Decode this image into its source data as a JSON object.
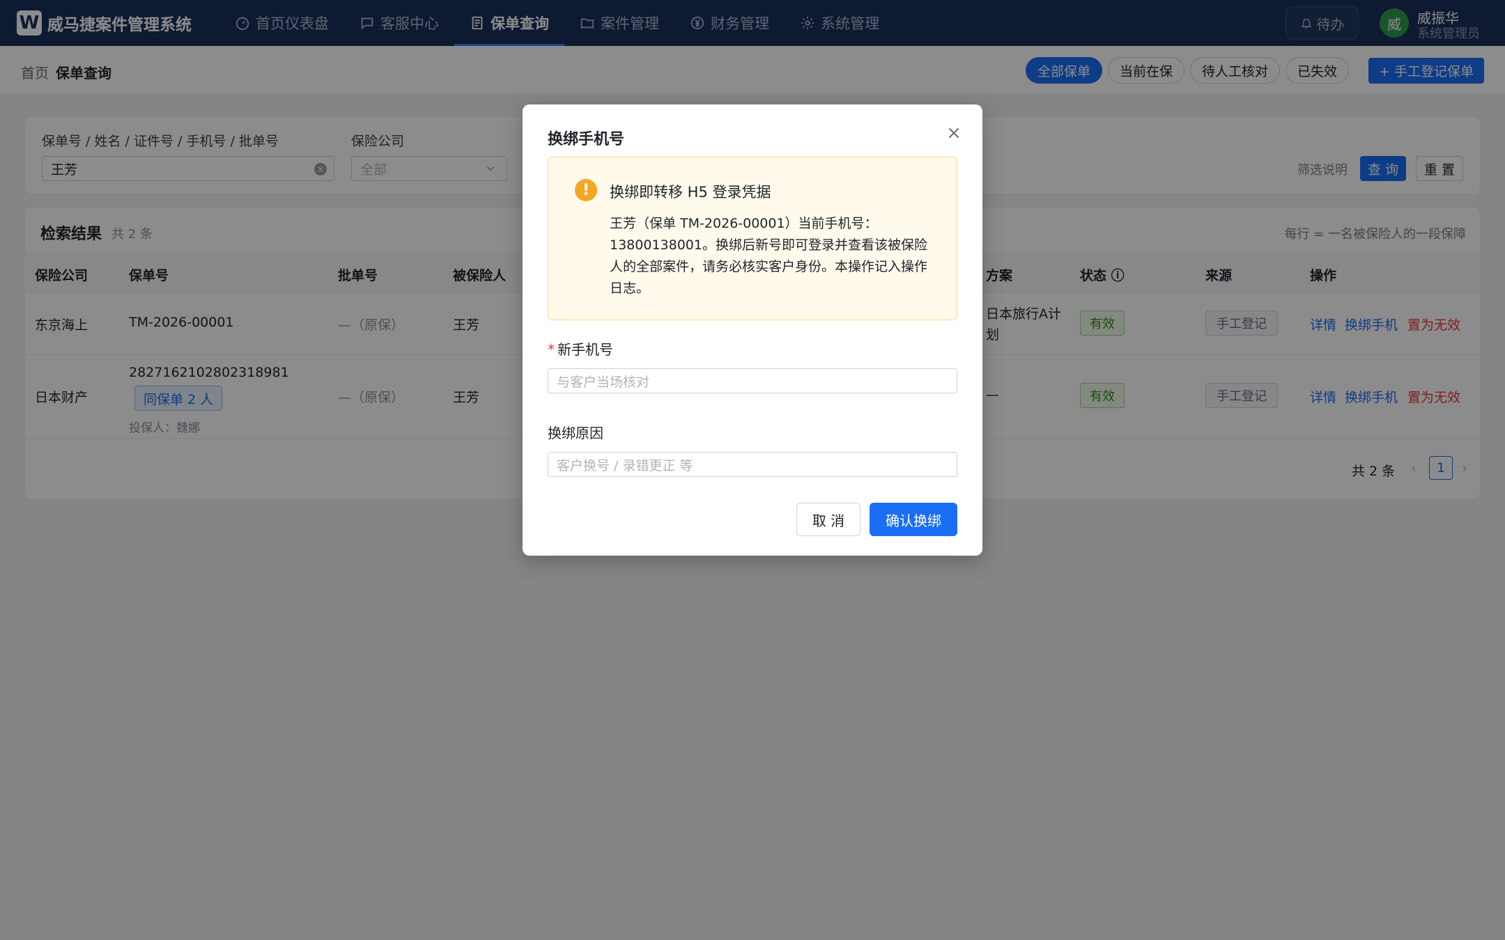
{
  "app": {
    "logo_letter": "W",
    "title": "威马捷案件管理系统"
  },
  "nav": [
    {
      "label": "首页仪表盘",
      "icon": "dashboard-icon"
    },
    {
      "label": "客服中心",
      "icon": "chat-icon"
    },
    {
      "label": "保单查询",
      "icon": "document-icon",
      "active": true
    },
    {
      "label": "案件管理",
      "icon": "folder-icon"
    },
    {
      "label": "财务管理",
      "icon": "yen-icon"
    },
    {
      "label": "系统管理",
      "icon": "gear-icon"
    }
  ],
  "header": {
    "todo_label": "待办",
    "avatar_text": "威",
    "user_name": "威振华",
    "user_role": "系统管理员"
  },
  "breadcrumb": {
    "home": "首页",
    "current": "保单查询"
  },
  "filter_tabs": [
    "全部保单",
    "当前在保",
    "待人工核对",
    "已失效"
  ],
  "add_button": "+ 手工登记保单",
  "search": {
    "keyword_label": "保单号 / 姓名 / 证件号 / 手机号 / 批单号",
    "keyword_value": "王芳",
    "company_label": "保险公司",
    "company_placeholder": "全部",
    "filter_note": "筛选说明",
    "query_button": "查 询",
    "reset_button": "重 置"
  },
  "results": {
    "title": "检索结果",
    "count": "共 2 条",
    "note": "每行 = 一名被保险人的一段保障",
    "columns": {
      "company": "保险公司",
      "policy_no": "保单号",
      "endorse_no": "批单号",
      "insured": "被保险人",
      "plan": "方案",
      "status": "状态 ⓘ",
      "source": "来源",
      "actions": "操作"
    },
    "rows": [
      {
        "company": "东京海上",
        "policy_no": "TM-2026-00001",
        "endorse_no": "—（原保）",
        "insured": "王芳",
        "plan_line1": "日本旅行A计",
        "plan_line2": "划",
        "status": "有效",
        "source": "手工登记"
      },
      {
        "company": "日本财产",
        "policy_no": "2827162102802318981",
        "same_tag": "同保单 2 人",
        "holder": "投保人：魏娜",
        "endorse_no": "—（原保）",
        "insured": "王芳",
        "plan_line1": "—",
        "status": "有效",
        "source": "手工登记"
      }
    ],
    "actions": {
      "detail": "详情",
      "rebind": "换绑手机",
      "invalidate": "置为无效"
    },
    "pager": {
      "total": "共 2 条",
      "page": "1",
      "prev": "‹",
      "next": "›"
    }
  },
  "modal": {
    "title": "换绑手机号",
    "warn_title": "换绑即转移 H5 登录凭据",
    "warn_body": "王芳（保单 TM-2026-00001）当前手机号：13800138001。换绑后新号即可登录并查看该被保险人的全部案件，请务必核实客户身份。本操作记入操作日志。",
    "phone_required_mark": "*",
    "phone_label": "新手机号",
    "phone_placeholder": "与客户当场核对",
    "reason_label": "换绑原因",
    "reason_placeholder": "客户换号 / 录错更正 等",
    "cancel": "取 消",
    "confirm": "确认换绑"
  },
  "colors": {
    "nav_bg": "#1b2f5c",
    "primary": "#1a6ef5",
    "danger": "#e5383b",
    "success": "#2f8a1e",
    "warning": "#f5a623"
  }
}
